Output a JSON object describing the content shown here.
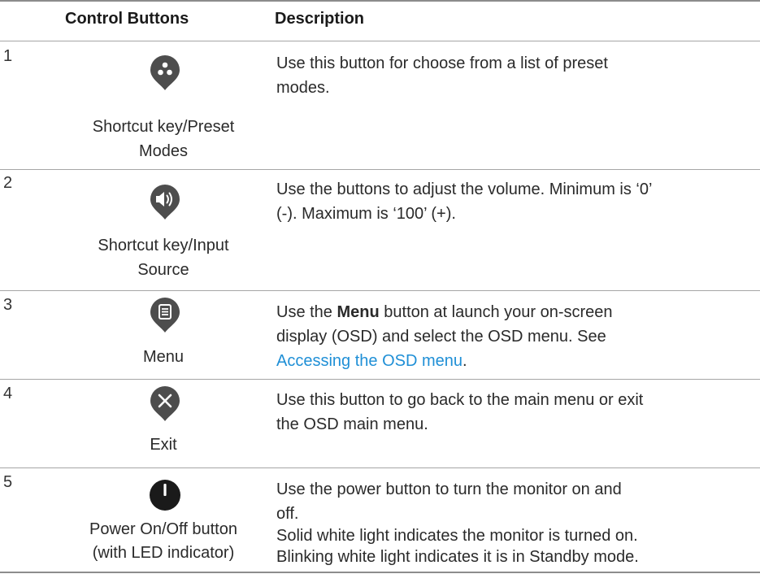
{
  "header": {
    "col1": "Control Buttons",
    "col2": "Description"
  },
  "rows": [
    {
      "num": "1",
      "icon": "preset-modes-icon",
      "label_lines": [
        "Shortcut key/Preset",
        "Modes"
      ],
      "desc_lines": [
        "Use this button for choose from a list of preset",
        "modes."
      ]
    },
    {
      "num": "2",
      "icon": "volume-icon",
      "label_lines": [
        "Shortcut key/Input",
        "Source"
      ],
      "desc_lines": [
        "Use the buttons to adjust the volume. Minimum is ‘0’",
        "(-). Maximum is ‘100’ (+)."
      ]
    },
    {
      "num": "3",
      "icon": "menu-icon",
      "label": "Menu",
      "desc_parts": {
        "pre": "Use the ",
        "bold": "Menu",
        "post": " button at launch your on-screen",
        "line2": "display (OSD) and select the OSD menu. See",
        "link": "Accessing the OSD menu",
        "link_suffix": "."
      }
    },
    {
      "num": "4",
      "icon": "exit-icon",
      "label": "Exit",
      "desc_lines": [
        "Use this button to go back to the main menu or exit",
        "the OSD main menu."
      ]
    },
    {
      "num": "5",
      "icon": "power-icon",
      "label_lines": [
        "Power On/Off button",
        "(with LED indicator)"
      ],
      "desc_lines": [
        "Use the power button to turn the monitor on and",
        "off.",
        "Solid white light indicates the monitor is turned on.",
        "Blinking white light indicates it is in Standby mode."
      ]
    }
  ],
  "colors": {
    "icon_fill": "#4d4d4d",
    "link": "#1f8fd6",
    "rule": "#8c8c8c"
  }
}
